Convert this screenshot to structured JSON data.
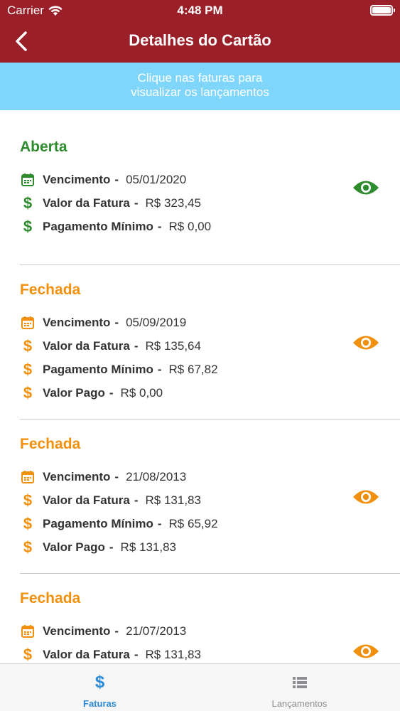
{
  "status_bar": {
    "carrier": "Carrier",
    "time": "4:48 PM"
  },
  "nav": {
    "title": "Detalhes do Cartão"
  },
  "banner": {
    "line1": "Clique nas faturas para",
    "line2": "visualizar os lançamentos"
  },
  "colors": {
    "header": "#9a1f28",
    "banner": "#7fd6fa",
    "open": "#2e8b2e",
    "closed": "#f0900e",
    "tab_active": "#2a8ad8",
    "tab_inactive": "#8e8e93"
  },
  "labels": {
    "due": "Vencimento",
    "amount": "Valor da Fatura",
    "minimum": "Pagamento Mínimo",
    "paid": "Valor Pago",
    "separator": "-"
  },
  "invoices": [
    {
      "status": "Aberta",
      "due": "05/01/2020",
      "amount": "R$ 323,45",
      "minimum": "R$ 0,00"
    },
    {
      "status": "Fechada",
      "due": "05/09/2019",
      "amount": "R$ 135,64",
      "minimum": "R$ 67,82",
      "paid": "R$ 0,00"
    },
    {
      "status": "Fechada",
      "due": "21/08/2013",
      "amount": "R$ 131,83",
      "minimum": "R$ 65,92",
      "paid": "R$ 131,83"
    },
    {
      "status": "Fechada",
      "due": "21/07/2013",
      "amount": "R$ 131,83"
    }
  ],
  "tabs": [
    {
      "label": "Faturas",
      "icon": "dollar-icon",
      "active": true
    },
    {
      "label": "Lançamentos",
      "icon": "list-icon",
      "active": false
    }
  ],
  "icons": {
    "currency": "$"
  }
}
